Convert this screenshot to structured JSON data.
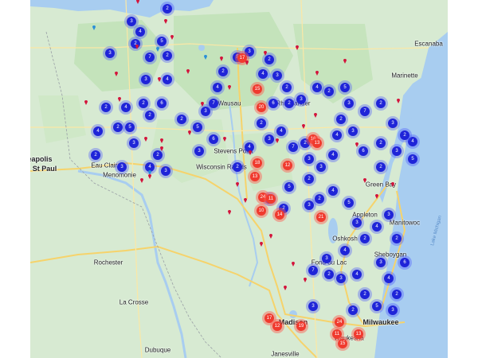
{
  "map": {
    "colors": {
      "land": "#d7ead2",
      "forest": "#bfdfb6",
      "water": "#a8cdf0",
      "road": "#f6d36b",
      "cluster_blue": "#1f24d8",
      "cluster_red": "#f03a2e",
      "pin_red": "#d3143c",
      "pin_blue": "#2a8fd8"
    },
    "cities": [
      {
        "name": "eapolis",
        "big": true
      },
      {
        "name": "St Paul",
        "big": true
      },
      {
        "name": "Milwaukee",
        "big": true
      },
      {
        "name": "Madison",
        "big": true
      },
      {
        "name": "Rochester",
        "big": false
      },
      {
        "name": "Green Bay",
        "big": false
      },
      {
        "name": "Appleton",
        "big": false
      },
      {
        "name": "Oshkosh",
        "big": false
      },
      {
        "name": "Wausau",
        "big": false
      },
      {
        "name": "Eau Claire",
        "big": false
      },
      {
        "name": "Stevens Point",
        "big": false
      },
      {
        "name": "Sheboygan",
        "big": false
      },
      {
        "name": "Manitowoc",
        "big": false
      },
      {
        "name": "Fond du Lac",
        "big": false
      },
      {
        "name": "La Crosse",
        "big": false
      },
      {
        "name": "Waukesha",
        "big": false
      },
      {
        "name": "Rhinelander",
        "big": false
      },
      {
        "name": "Marinette",
        "big": false
      },
      {
        "name": "Escanaba",
        "big": false
      },
      {
        "name": "Menomonie",
        "big": false
      },
      {
        "name": "Wisconsin Rapids",
        "big": false
      },
      {
        "name": "Janesville",
        "big": false
      },
      {
        "name": "Dubuque",
        "big": false
      }
    ],
    "water_labels": [
      "Lake Michigan"
    ],
    "clusters": [
      {
        "count": "4",
        "color": "blue"
      },
      {
        "count": "2",
        "color": "blue"
      },
      {
        "count": "3",
        "color": "blue"
      },
      {
        "count": "7",
        "color": "blue"
      },
      {
        "count": "2",
        "color": "blue"
      },
      {
        "count": "5",
        "color": "blue"
      },
      {
        "count": "2",
        "color": "blue"
      },
      {
        "count": "3",
        "color": "blue"
      },
      {
        "count": "4",
        "color": "blue"
      },
      {
        "count": "3",
        "color": "blue"
      },
      {
        "count": "2",
        "color": "blue"
      },
      {
        "count": "6",
        "color": "blue"
      },
      {
        "count": "2",
        "color": "blue"
      },
      {
        "count": "2",
        "color": "blue"
      },
      {
        "count": "3",
        "color": "blue"
      },
      {
        "count": "7",
        "color": "blue"
      },
      {
        "count": "4",
        "color": "blue"
      },
      {
        "count": "2",
        "color": "blue"
      },
      {
        "count": "5",
        "color": "blue"
      },
      {
        "count": "3",
        "color": "blue"
      },
      {
        "count": "2",
        "color": "blue"
      },
      {
        "count": "4",
        "color": "blue"
      },
      {
        "count": "3",
        "color": "blue"
      },
      {
        "count": "2",
        "color": "blue"
      },
      {
        "count": "6",
        "color": "blue"
      },
      {
        "count": "2",
        "color": "blue"
      },
      {
        "count": "3",
        "color": "blue"
      },
      {
        "count": "4",
        "color": "blue"
      },
      {
        "count": "2",
        "color": "blue"
      },
      {
        "count": "5",
        "color": "blue"
      },
      {
        "count": "3",
        "color": "blue"
      },
      {
        "count": "2",
        "color": "blue"
      },
      {
        "count": "4",
        "color": "blue"
      },
      {
        "count": "3",
        "color": "blue"
      },
      {
        "count": "7",
        "color": "blue"
      },
      {
        "count": "2",
        "color": "blue"
      },
      {
        "count": "2",
        "color": "blue"
      },
      {
        "count": "3",
        "color": "blue"
      },
      {
        "count": "4",
        "color": "blue"
      },
      {
        "count": "5",
        "color": "blue"
      },
      {
        "count": "2",
        "color": "blue"
      },
      {
        "count": "3",
        "color": "blue"
      },
      {
        "count": "6",
        "color": "blue"
      },
      {
        "count": "2",
        "color": "blue"
      },
      {
        "count": "4",
        "color": "blue"
      },
      {
        "count": "3",
        "color": "blue"
      },
      {
        "count": "2",
        "color": "blue"
      },
      {
        "count": "5",
        "color": "blue"
      },
      {
        "count": "2",
        "color": "blue"
      },
      {
        "count": "3",
        "color": "blue"
      },
      {
        "count": "4",
        "color": "blue"
      },
      {
        "count": "7",
        "color": "blue"
      },
      {
        "count": "2",
        "color": "blue"
      },
      {
        "count": "3",
        "color": "blue"
      },
      {
        "count": "4",
        "color": "blue"
      },
      {
        "count": "2",
        "color": "blue"
      },
      {
        "count": "6",
        "color": "blue"
      },
      {
        "count": "3",
        "color": "blue"
      },
      {
        "count": "5",
        "color": "blue"
      },
      {
        "count": "2",
        "color": "blue"
      },
      {
        "count": "4",
        "color": "blue"
      },
      {
        "count": "3",
        "color": "blue"
      },
      {
        "count": "2",
        "color": "blue"
      },
      {
        "count": "3",
        "color": "blue"
      },
      {
        "count": "4",
        "color": "blue"
      },
      {
        "count": "2",
        "color": "blue"
      },
      {
        "count": "5",
        "color": "blue"
      },
      {
        "count": "3",
        "color": "blue"
      },
      {
        "count": "2",
        "color": "blue"
      },
      {
        "count": "4",
        "color": "blue"
      },
      {
        "count": "6",
        "color": "blue"
      },
      {
        "count": "2",
        "color": "blue"
      },
      {
        "count": "3",
        "color": "blue"
      },
      {
        "count": "2",
        "color": "blue"
      },
      {
        "count": "4",
        "color": "blue"
      },
      {
        "count": "5",
        "color": "blue"
      },
      {
        "count": "3",
        "color": "blue"
      },
      {
        "count": "2",
        "color": "blue"
      },
      {
        "count": "4",
        "color": "blue"
      },
      {
        "count": "3",
        "color": "blue"
      },
      {
        "count": "7",
        "color": "blue"
      },
      {
        "count": "2",
        "color": "blue"
      },
      {
        "count": "3",
        "color": "blue"
      },
      {
        "count": "4",
        "color": "blue"
      },
      {
        "count": "2",
        "color": "blue"
      },
      {
        "count": "5",
        "color": "blue"
      },
      {
        "count": "3",
        "color": "blue"
      },
      {
        "count": "2",
        "color": "blue"
      },
      {
        "count": "4",
        "color": "blue"
      },
      {
        "count": "3",
        "color": "blue"
      },
      {
        "count": "2",
        "color": "blue"
      },
      {
        "count": "6",
        "color": "blue"
      },
      {
        "count": "3",
        "color": "blue"
      },
      {
        "count": "4",
        "color": "blue"
      },
      {
        "count": "2",
        "color": "blue"
      },
      {
        "count": "3",
        "color": "blue"
      },
      {
        "count": "17",
        "color": "red"
      },
      {
        "count": "15",
        "color": "red"
      },
      {
        "count": "20",
        "color": "red"
      },
      {
        "count": "12",
        "color": "red"
      },
      {
        "count": "18",
        "color": "red"
      },
      {
        "count": "13",
        "color": "red"
      },
      {
        "count": "24",
        "color": "red"
      },
      {
        "count": "11",
        "color": "red"
      },
      {
        "count": "10",
        "color": "red"
      },
      {
        "count": "14",
        "color": "red"
      },
      {
        "count": "16",
        "color": "red"
      },
      {
        "count": "13",
        "color": "red"
      },
      {
        "count": "21",
        "color": "red"
      },
      {
        "count": "17",
        "color": "red"
      },
      {
        "count": "12",
        "color": "red"
      },
      {
        "count": "19",
        "color": "red"
      },
      {
        "count": "24",
        "color": "red"
      },
      {
        "count": "11",
        "color": "red"
      },
      {
        "count": "15",
        "color": "red"
      },
      {
        "count": "13",
        "color": "red"
      }
    ],
    "pins": [
      {
        "color": "red"
      },
      {
        "color": "red"
      },
      {
        "color": "blue"
      },
      {
        "color": "red"
      },
      {
        "color": "red"
      },
      {
        "color": "blue"
      },
      {
        "color": "red"
      },
      {
        "color": "red"
      },
      {
        "color": "red"
      },
      {
        "color": "blue"
      },
      {
        "color": "red"
      },
      {
        "color": "red"
      },
      {
        "color": "red"
      },
      {
        "color": "red"
      },
      {
        "color": "red"
      },
      {
        "color": "red"
      },
      {
        "color": "red"
      },
      {
        "color": "red"
      },
      {
        "color": "red"
      },
      {
        "color": "red"
      },
      {
        "color": "red"
      },
      {
        "color": "red"
      },
      {
        "color": "blue"
      },
      {
        "color": "red"
      },
      {
        "color": "red"
      },
      {
        "color": "red"
      },
      {
        "color": "red"
      },
      {
        "color": "red"
      },
      {
        "color": "red"
      },
      {
        "color": "red"
      },
      {
        "color": "red"
      },
      {
        "color": "red"
      },
      {
        "color": "red"
      },
      {
        "color": "red"
      },
      {
        "color": "red"
      },
      {
        "color": "red"
      },
      {
        "color": "red"
      },
      {
        "color": "red"
      },
      {
        "color": "red"
      },
      {
        "color": "red"
      },
      {
        "color": "red"
      },
      {
        "color": "red"
      },
      {
        "color": "red"
      },
      {
        "color": "red"
      },
      {
        "color": "red"
      }
    ]
  }
}
